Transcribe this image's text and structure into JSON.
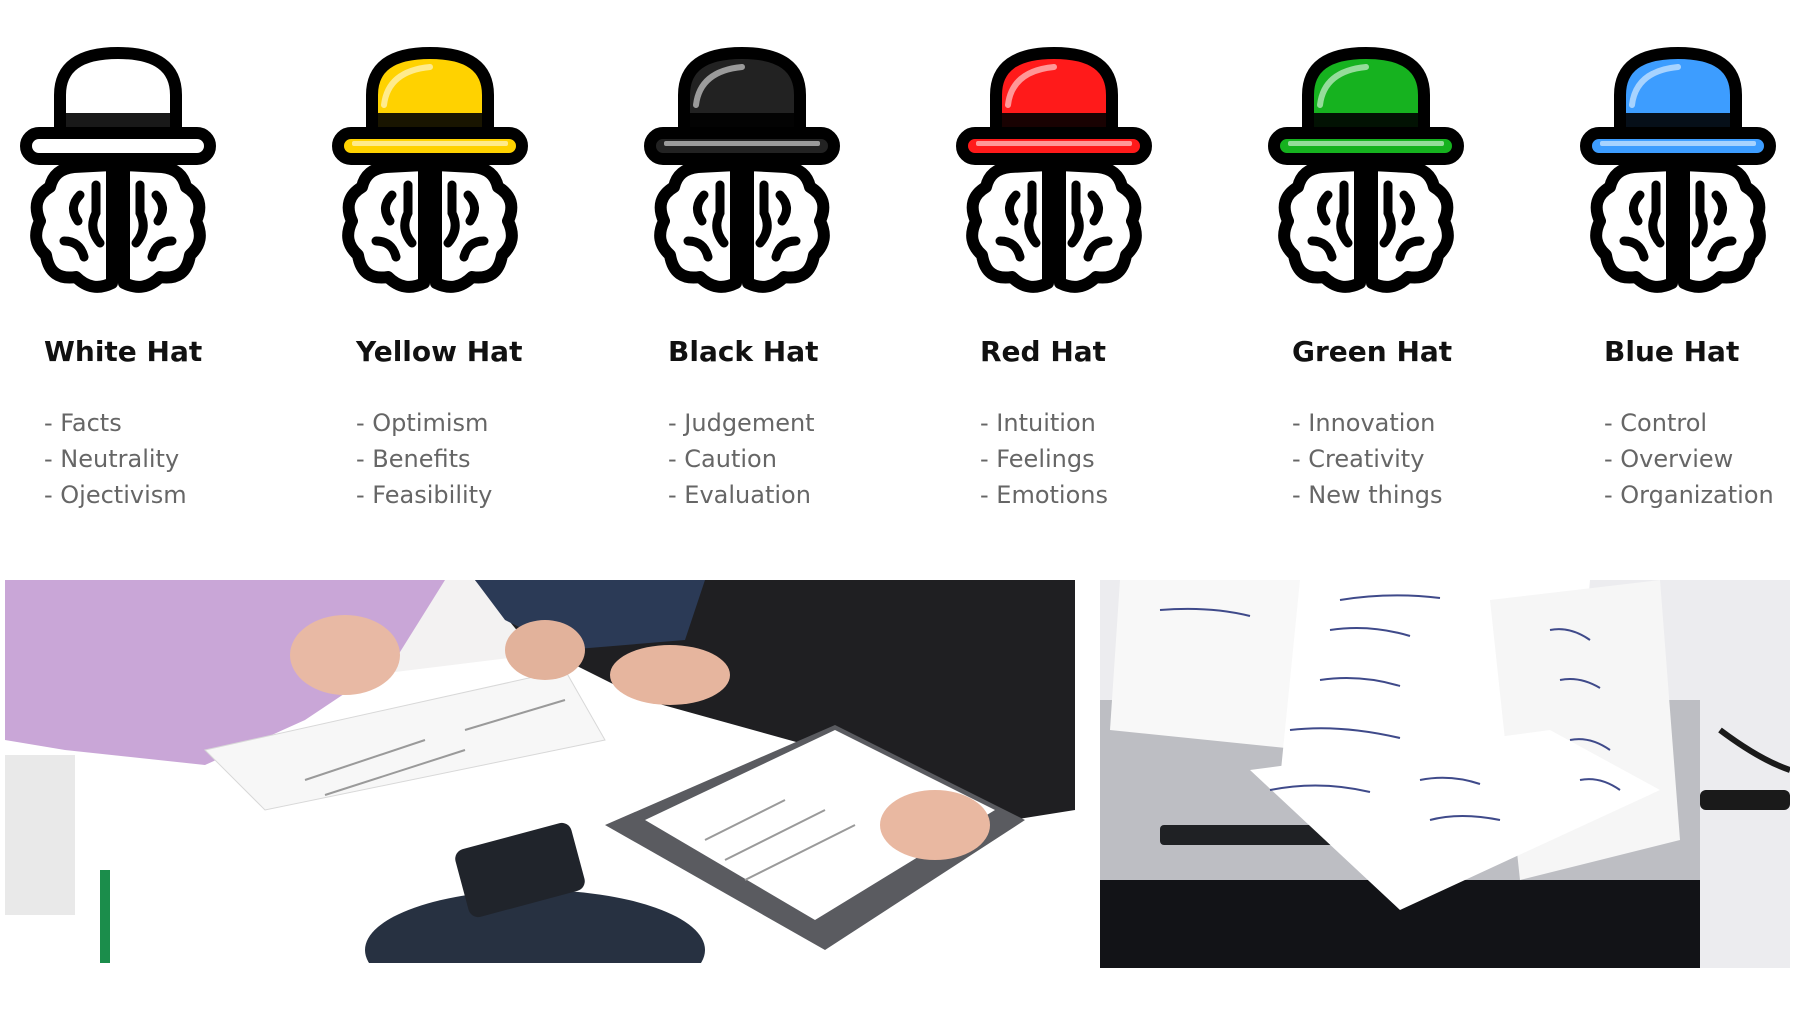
{
  "hats": [
    {
      "name": "White Hat",
      "color": "#ffffff",
      "traits": [
        "- Facts",
        "- Neutrality",
        "- Ojectivism"
      ],
      "icon": "white-hat-brain-icon"
    },
    {
      "name": "Yellow Hat",
      "color": "#ffd200",
      "traits": [
        "- Optimism",
        "- Benefits",
        "- Feasibility"
      ],
      "icon": "yellow-hat-brain-icon"
    },
    {
      "name": "Black Hat",
      "color": "#222222",
      "traits": [
        "- Judgement",
        "- Caution",
        "- Evaluation"
      ],
      "icon": "black-hat-brain-icon"
    },
    {
      "name": "Red Hat",
      "color": "#ff1a1a",
      "traits": [
        "- Intuition",
        "- Feelings",
        "- Emotions"
      ],
      "icon": "red-hat-brain-icon"
    },
    {
      "name": "Green Hat",
      "color": "#16b21f",
      "traits": [
        "- Innovation",
        "- Creativity",
        "- New things"
      ],
      "icon": "green-hat-brain-icon"
    },
    {
      "name": "Blue Hat",
      "color": "#3d9dff",
      "traits": [
        "- Control",
        "- Overview",
        "- Organization"
      ],
      "icon": "blue-hat-brain-icon"
    }
  ],
  "photos": [
    {
      "name": "workshop-table-photo"
    },
    {
      "name": "sticky-notes-laptop-photo"
    }
  ]
}
